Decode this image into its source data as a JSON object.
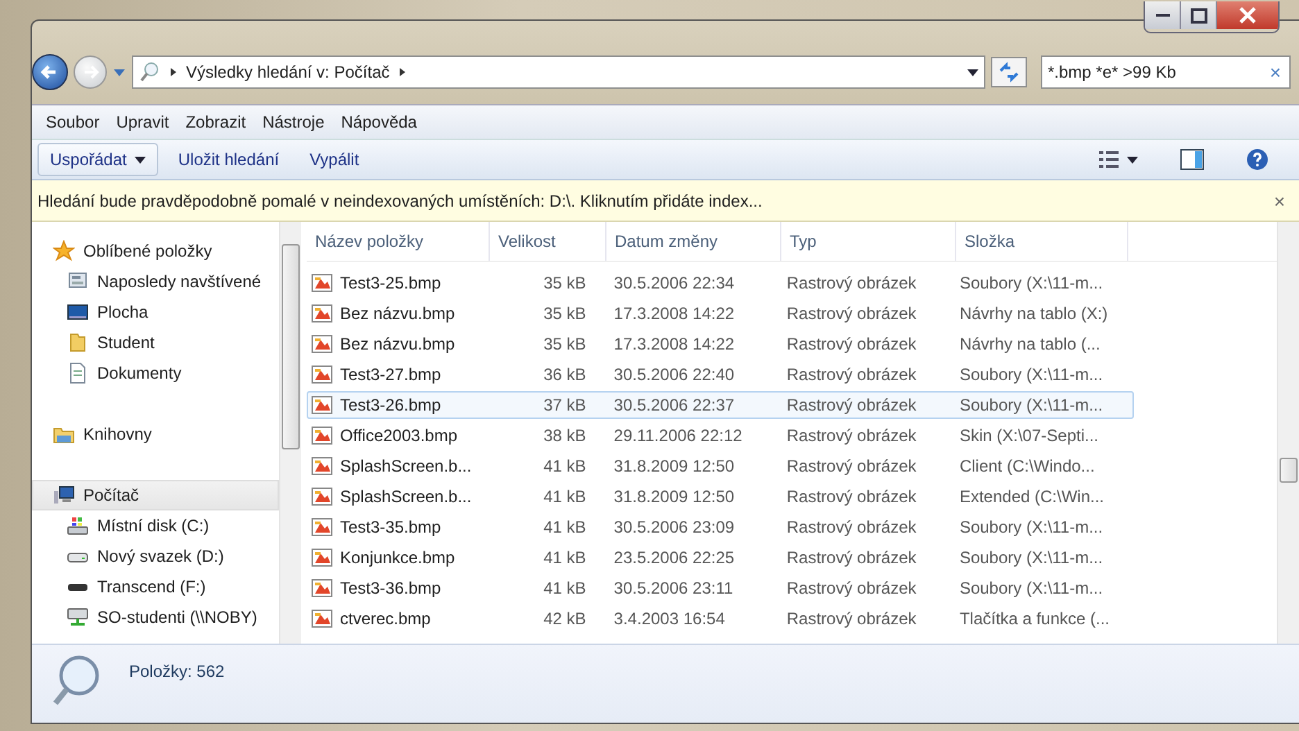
{
  "address_bar": {
    "path": "Výsledky hledání v: Počítač"
  },
  "search": {
    "value": "*.bmp *e* >99 Kb",
    "clear": "×"
  },
  "menu": [
    "Soubor",
    "Upravit",
    "Zobrazit",
    "Nástroje",
    "Nápověda"
  ],
  "toolbar": [
    {
      "label": "Uspořádat",
      "kind": "dropdown"
    },
    {
      "label": "Uložit hledání",
      "kind": "plain"
    },
    {
      "label": "Vypálit",
      "kind": "plain"
    }
  ],
  "info_bar": {
    "text": "Hledání bude pravděpodobně pomalé v neindexovaných umístěních: D:\\. Kliknutím přidáte index...",
    "close": "×"
  },
  "sidebar": {
    "items": [
      {
        "label": "Oblíbené položky",
        "kind": "group",
        "selected": false,
        "children": [
          {
            "label": "Naposledy navštívené",
            "selected": false
          },
          {
            "label": "Plocha",
            "selected": false
          },
          {
            "label": "Student",
            "selected": false
          },
          {
            "label": "Dokumenty",
            "selected": false
          }
        ]
      },
      {
        "label": "Knihovny",
        "kind": "group",
        "selected": false
      },
      {
        "label": "Počítač",
        "kind": "group",
        "selected": true,
        "children": [
          {
            "label": "Místní disk (C:)",
            "selected": false
          },
          {
            "label": "Nový svazek (D:)",
            "selected": false
          },
          {
            "label": "Transcend (F:)",
            "selected": false
          },
          {
            "label": "SO-studenti (\\\\NOBY)",
            "selected": false
          }
        ]
      }
    ]
  },
  "table": {
    "columns": [
      "Název položky",
      "Velikost",
      "Datum změny",
      "Typ",
      "Složka"
    ],
    "rows": [
      {
        "cells": [
          "Test3-25.bmp",
          "35 kB",
          "30.5.2006 22:34",
          "Rastrový obrázek",
          "Soubory (X:\\11-m..."
        ],
        "selected": false
      },
      {
        "cells": [
          "Bez názvu.bmp",
          "35 kB",
          "17.3.2008 14:22",
          "Rastrový obrázek",
          "Návrhy na tablo (X:)"
        ],
        "selected": false
      },
      {
        "cells": [
          "Bez názvu.bmp",
          "35 kB",
          "17.3.2008 14:22",
          "Rastrový obrázek",
          "Návrhy na tablo (..."
        ],
        "selected": false
      },
      {
        "cells": [
          "Test3-27.bmp",
          "36 kB",
          "30.5.2006 22:40",
          "Rastrový obrázek",
          "Soubory (X:\\11-m..."
        ],
        "selected": false
      },
      {
        "cells": [
          "Test3-26.bmp",
          "37 kB",
          "30.5.2006 22:37",
          "Rastrový obrázek",
          "Soubory (X:\\11-m..."
        ],
        "selected": true
      },
      {
        "cells": [
          "Office2003.bmp",
          "38 kB",
          "29.11.2006 22:12",
          "Rastrový obrázek",
          "Skin (X:\\07-Septi..."
        ],
        "selected": false
      },
      {
        "cells": [
          "SplashScreen.b...",
          "41 kB",
          "31.8.2009 12:50",
          "Rastrový obrázek",
          "Client (C:\\Windo..."
        ],
        "selected": false
      },
      {
        "cells": [
          "SplashScreen.b...",
          "41 kB",
          "31.8.2009 12:50",
          "Rastrový obrázek",
          "Extended (C:\\Win..."
        ],
        "selected": false
      },
      {
        "cells": [
          "Test3-35.bmp",
          "41 kB",
          "30.5.2006 23:09",
          "Rastrový obrázek",
          "Soubory (X:\\11-m..."
        ],
        "selected": false
      },
      {
        "cells": [
          "Konjunkce.bmp",
          "41 kB",
          "23.5.2006 22:25",
          "Rastrový obrázek",
          "Soubory (X:\\11-m..."
        ],
        "selected": false
      },
      {
        "cells": [
          "Test3-36.bmp",
          "41 kB",
          "30.5.2006 23:11",
          "Rastrový obrázek",
          "Soubory (X:\\11-m..."
        ],
        "selected": false
      },
      {
        "cells": [
          "ctverec.bmp",
          "42 kB",
          "3.4.2003 16:54",
          "Rastrový obrázek",
          "Tlačítka a funkce (..."
        ],
        "selected": false
      }
    ]
  },
  "status_bar": {
    "text": "Položky: 562"
  }
}
